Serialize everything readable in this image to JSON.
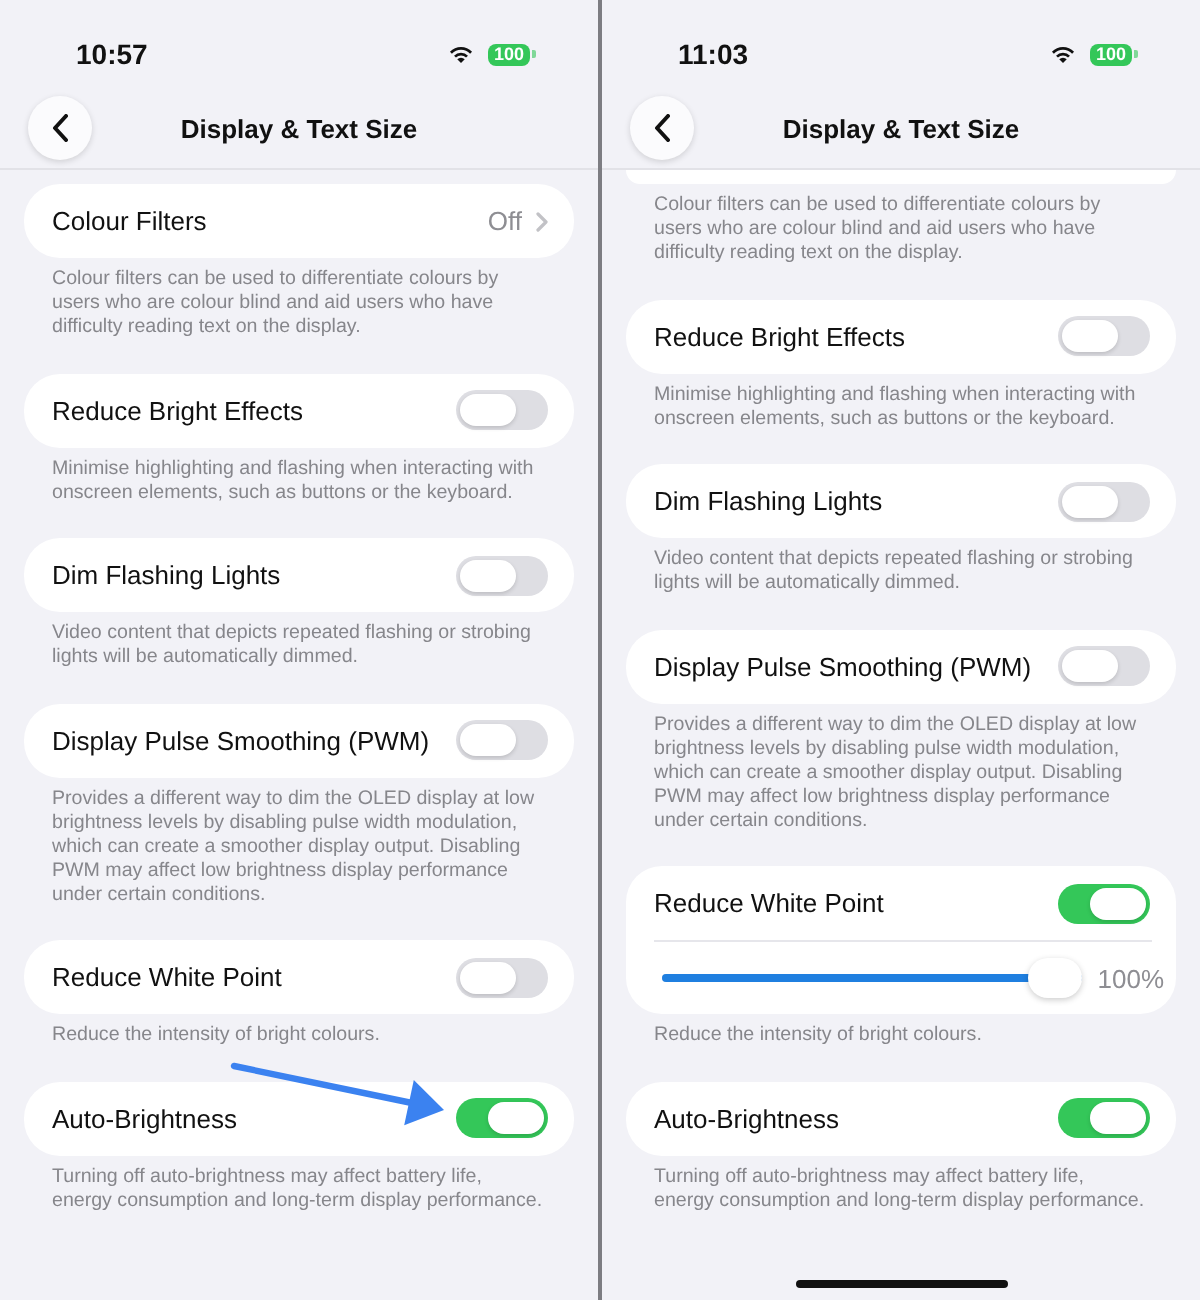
{
  "screens": [
    {
      "status_bar": {
        "time": "10:57",
        "battery": "100"
      },
      "nav": {
        "title": "Display & Text Size"
      },
      "sections": [
        {
          "kind": "link",
          "label": "Colour Filters",
          "value": "Off",
          "description": "Colour filters can be used to differentiate colours by users who are colour blind and aid users who have difficulty reading text on the display.",
          "pointer_arrow": false
        },
        {
          "kind": "toggle",
          "label": "Reduce Bright Effects",
          "on": false,
          "description": "Minimise highlighting and flashing when interacting with onscreen elements, such as buttons or the keyboard.",
          "pointer_arrow": false
        },
        {
          "kind": "toggle",
          "label": "Dim Flashing Lights",
          "on": false,
          "description": "Video content that depicts repeated flashing or strobing lights will be automatically dimmed.",
          "pointer_arrow": false
        },
        {
          "kind": "toggle",
          "label": "Display Pulse Smoothing (PWM)",
          "on": false,
          "description": "Provides a different way to dim the OLED display at low brightness levels by disabling pulse width modulation, which can create a smoother display output. Disabling PWM may affect low brightness display performance under certain conditions.",
          "pointer_arrow": false
        },
        {
          "kind": "toggle",
          "label": "Reduce White Point",
          "on": false,
          "description": "Reduce the intensity of bright colours.",
          "pointer_arrow": false
        },
        {
          "kind": "toggle",
          "label": "Auto-Brightness",
          "on": true,
          "description": "Turning off auto-brightness may affect battery life, energy consumption and long-term display performance.",
          "pointer_arrow": true
        }
      ]
    },
    {
      "status_bar": {
        "time": "11:03",
        "battery": "100"
      },
      "nav": {
        "title": "Display & Text Size"
      },
      "sections": [
        {
          "kind": "clipped",
          "description": "Colour filters can be used to differentiate colours by users who are colour blind and aid users who have difficulty reading text on the display.",
          "pointer_arrow": false
        },
        {
          "kind": "toggle",
          "label": "Reduce Bright Effects",
          "on": false,
          "description": "Minimise highlighting and flashing when interacting with onscreen elements, such as buttons or the keyboard.",
          "pointer_arrow": false
        },
        {
          "kind": "toggle",
          "label": "Dim Flashing Lights",
          "on": false,
          "description": "Video content that depicts repeated flashing or strobing lights will be automatically dimmed.",
          "pointer_arrow": false
        },
        {
          "kind": "toggle",
          "label": "Display Pulse Smoothing (PWM)",
          "on": false,
          "description": "Provides a different way to dim the OLED display at low brightness levels by disabling pulse width modulation, which can create a smoother display output. Disabling PWM may affect low brightness display performance under certain conditions.",
          "pointer_arrow": false
        },
        {
          "kind": "toggle",
          "label": "Reduce White Point",
          "on": true,
          "slider": {
            "level": 1,
            "reading": "100%"
          },
          "description": "Reduce the intensity of bright colours.",
          "pointer_arrow": false
        },
        {
          "kind": "toggle",
          "label": "Auto-Brightness",
          "on": true,
          "description": "Turning off auto-brightness may affect battery life, energy consumption and long-term display performance.",
          "pointer_arrow": false
        }
      ],
      "home_indicator": true
    }
  ]
}
